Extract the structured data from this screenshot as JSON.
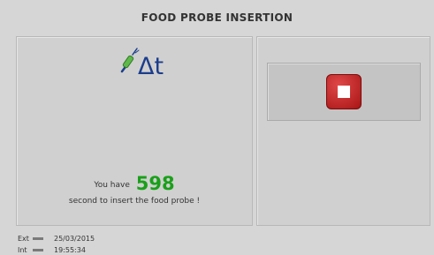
{
  "header": {
    "title": "FOOD PROBE INSERTION"
  },
  "probe_icon": {
    "name": "food-probe-delta-t-icon",
    "glyph": "Δt",
    "color": "#1b3d8c"
  },
  "message": {
    "prefix": "You have",
    "seconds": "598",
    "suffix": "second to insert the food probe !"
  },
  "stop_button": {
    "icon": "stop-icon",
    "color": "#c01e1e"
  },
  "status": {
    "ext_label": "Ext",
    "date": "25/03/2015",
    "int_label": "Int",
    "time": "19:55:34"
  },
  "colors": {
    "background": "#d6d6d6",
    "countdown": "#1aa01a"
  }
}
